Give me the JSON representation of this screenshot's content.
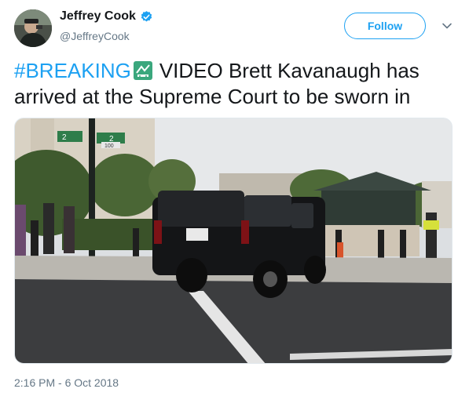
{
  "author": {
    "display_name": "Jeffrey Cook",
    "handle": "@JeffreyCook",
    "verified": true,
    "avatar_icon": "person-photo"
  },
  "actions": {
    "follow_label": "Follow",
    "more_icon": "chevron-down-icon"
  },
  "tweet": {
    "hashtag": "#BREAKING",
    "emoji_icon": "train-emoji-icon",
    "text": "VIDEO Brett Kavanaugh has arrived at the Supreme Court to be sworn in"
  },
  "media": {
    "street_sign_1": "2",
    "street_sign_2": "2",
    "street_sign_sub": "100"
  },
  "timestamp": "2:16 PM - 6 Oct 2018",
  "colors": {
    "accent": "#1da1f2",
    "text": "#14171a",
    "muted": "#657786"
  }
}
